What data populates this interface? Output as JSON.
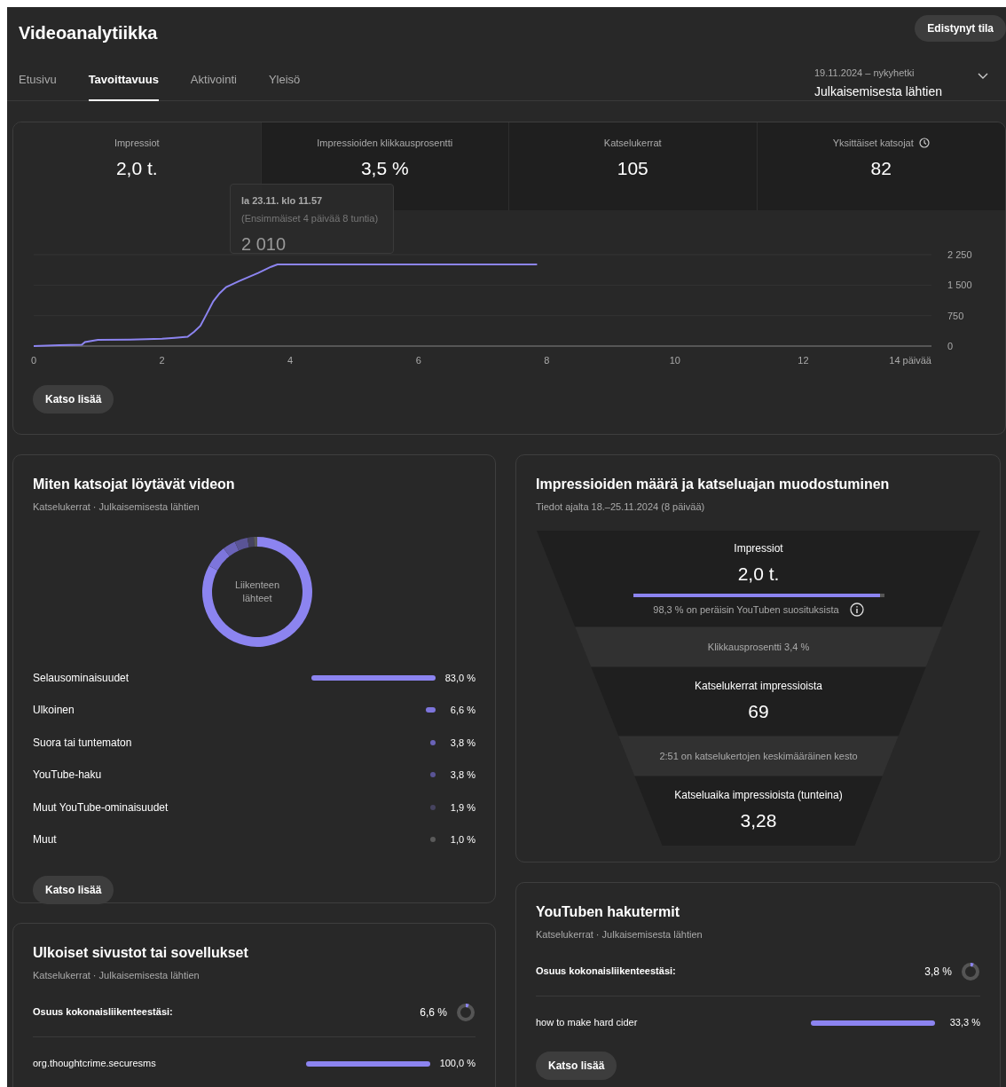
{
  "header": {
    "title": "Videoanalytiikka",
    "advanced_button": "Edistynyt tila"
  },
  "tabs": [
    {
      "label": "Etusivu",
      "selected": false
    },
    {
      "label": "Tavoittavuus",
      "selected": true
    },
    {
      "label": "Aktivointi",
      "selected": false
    },
    {
      "label": "Yleisö",
      "selected": false
    }
  ],
  "date_range": {
    "range": "19.11.2024 – nykyhetki",
    "label": "Julkaisemisesta lähtien"
  },
  "overview": {
    "metrics": [
      {
        "label": "Impressiot",
        "value": "2,0 t.",
        "selected": true,
        "has_icon": false
      },
      {
        "label": "Impressioiden klikkausprosentti",
        "value": "3,5 %",
        "selected": false,
        "has_icon": false
      },
      {
        "label": "Katselukerrat",
        "value": "105",
        "selected": false,
        "has_icon": false
      },
      {
        "label": "Yksittäiset katsojat",
        "value": "82",
        "selected": false,
        "has_icon": true
      }
    ],
    "tooltip": {
      "date": "la 23.11. klo 11.57",
      "period": "(Ensimmäiset 4 päivää 8 tuntia)",
      "value": "2 010"
    },
    "chart_data": {
      "type": "line",
      "x": [
        0,
        0.4,
        0.75,
        0.8,
        1.0,
        1.5,
        2.0,
        2.2,
        2.4,
        2.5,
        2.6,
        2.7,
        2.8,
        2.9,
        3.0,
        3.2,
        3.5,
        3.7,
        3.8,
        5,
        7.85
      ],
      "series": [
        {
          "color": "#8c84f0",
          "values": [
            0,
            20,
            30,
            100,
            150,
            160,
            180,
            200,
            230,
            350,
            500,
            800,
            1100,
            1300,
            1450,
            1600,
            1800,
            1950,
            2010,
            2010,
            2010
          ]
        }
      ],
      "xlim": [
        0,
        14
      ],
      "ylim": [
        0,
        2250
      ],
      "xticks": [
        0,
        2,
        4,
        6,
        8,
        10,
        12,
        {
          "value": 14,
          "label": "14 päivää"
        }
      ],
      "yticks": [
        0,
        {
          "value": 750,
          "label": "750"
        },
        {
          "value": 1500,
          "label": "1 500"
        },
        {
          "value": 2250,
          "label": "2 250"
        }
      ]
    },
    "button": "Katso lisää"
  },
  "traffic_sources": {
    "title": "Miten katsojat löytävät videon",
    "subtitle": "Katselukerrat · Julkaisemisesta lähtien",
    "chart_data": {
      "type": "donut",
      "title": "Liikenteen lähteet",
      "categories": [
        "Selausominaisuudet",
        "Ulkoinen",
        "Suora tai tuntematon",
        "YouTube-haku",
        "Muut YouTube-ominaisuudet",
        "Muut"
      ],
      "values": [
        83.0,
        6.6,
        3.8,
        3.8,
        1.9,
        1.0
      ]
    },
    "rows": [
      {
        "value": "83,0 %",
        "color": "#8c84f0"
      },
      {
        "value": "6,6 %",
        "color": "#7d75dc"
      },
      {
        "value": "3,8 %",
        "color": "#6a63b8"
      },
      {
        "value": "3,8 %",
        "color": "#5a5496"
      },
      {
        "value": "1,9 %",
        "color": "#46435f"
      },
      {
        "value": "1,0 %",
        "color": "#5a5a5a"
      }
    ],
    "button": "Katso lisää"
  },
  "funnel": {
    "title": "Impressioiden määrä ja katseluajan muodostuminen",
    "subtitle": "Tiedot ajalta 18.–25.11.2024 (8 päivää)",
    "stages": [
      {
        "kind": "metric",
        "label": "Impressiot",
        "value": "2,0 t.",
        "level": 0.983,
        "note": "98,3 % on peräisin YouTuben suosituksista"
      },
      {
        "kind": "rate",
        "text": "Klikkausprosentti 3,4 %"
      },
      {
        "kind": "metric",
        "label": "Katselukerrat impressioista",
        "value": "69"
      },
      {
        "kind": "rate",
        "text": "2:51 on katselukertojen keskimääräinen kesto"
      },
      {
        "kind": "metric",
        "label": "Katseluaika impressioista (tunteina)",
        "value": "3,28"
      }
    ]
  },
  "external_sites": {
    "title": "Ulkoiset sivustot tai sovellukset",
    "subtitle": "Katselukerrat · Julkaisemisesta lähtien",
    "share": {
      "label": "Osuus kokonaisliikenteestäsi:",
      "value": "6,6 %"
    },
    "rows": [
      {
        "label": "org.thoughtcrime.securesms",
        "value": "100,0 %"
      }
    ]
  },
  "search_terms": {
    "title": "YouTuben hakutermit",
    "subtitle": "Katselukerrat · Julkaisemisesta lähtien",
    "share": {
      "label": "Osuus kokonaisliikenteestäsi:",
      "value": "3,8 %"
    },
    "rows": [
      {
        "label": "how to make hard cider",
        "value": "33,3 %"
      }
    ],
    "button": "Katso lisää"
  }
}
